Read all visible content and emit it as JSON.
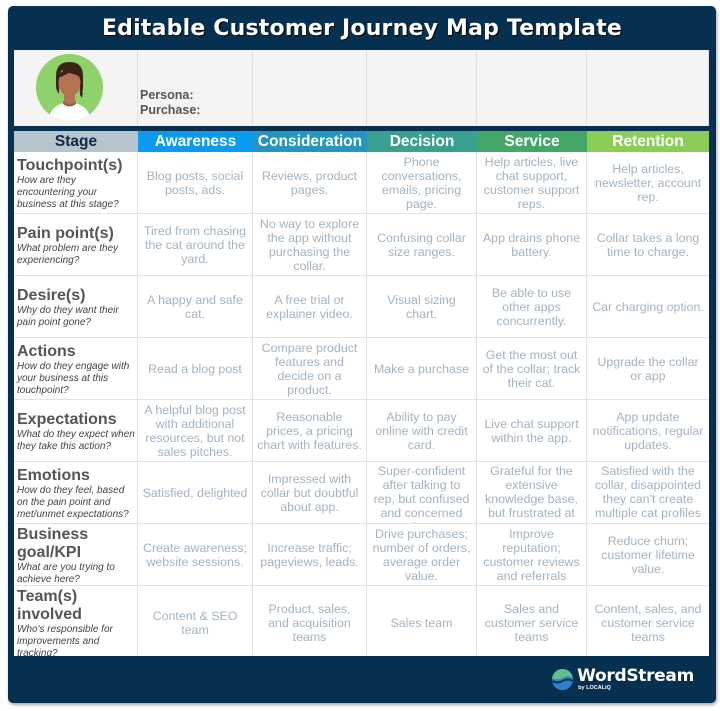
{
  "title": "Editable Customer Journey Map Template",
  "persona": {
    "persona_label": "Persona:",
    "purchase_label": "Purchase:"
  },
  "header": {
    "stage": {
      "label": "Stage",
      "color": "#b7c4cc"
    },
    "stages": [
      {
        "label": "Awareness",
        "color": "#0a9bef"
      },
      {
        "label": "Consideration",
        "color": "#2496c1"
      },
      {
        "label": "Decision",
        "color": "#3aa090"
      },
      {
        "label": "Service",
        "color": "#44a667"
      },
      {
        "label": "Retention",
        "color": "#8ccd58"
      }
    ]
  },
  "rows": [
    {
      "title": "Touchpoint(s)",
      "subtitle": "How are they encountering your business at this stage?",
      "cells": [
        "Blog posts, social posts, ads.",
        "Reviews, product pages.",
        "Phone conversations, emails, pricing page.",
        "Help articles, live chat support, customer support reps.",
        "Help articles, newsletter, account rep."
      ]
    },
    {
      "title": "Pain point(s)",
      "subtitle": "What problem are they experiencing?",
      "cells": [
        "Tired from chasing the cat around the yard.",
        "No way to explore the app without purchasing the collar.",
        "Confusing collar size ranges.",
        "App drains phone battery.",
        "Collar takes a long time to charge."
      ]
    },
    {
      "title": "Desire(s)",
      "subtitle": "Why do they want their pain point gone?",
      "cells": [
        "A happy and safe cat.",
        "A free trial or explainer video.",
        "Visual sizing chart.",
        "Be able to use other apps concurrently.",
        "Car charging option."
      ]
    },
    {
      "title": "Actions",
      "subtitle": "How do they engage with your business at this touchpoint?",
      "cells": [
        "Read a blog post",
        "Compare product features and decide on a product.",
        "Make a purchase",
        "Get the most out of the collar; track their cat.",
        "Upgrade the collar or app"
      ]
    },
    {
      "title": "Expectations",
      "subtitle": "What do they expect when they take this action?",
      "cells": [
        "A helpful blog post with additional resources, but not sales pitches.",
        "Reasonable prices, a pricing chart with features.",
        "Ability to pay online with credit card.",
        "Live chat support within the app.",
        "App update notifications, regular updates."
      ]
    },
    {
      "title": "Emotions",
      "subtitle": "How do they feel, based on the pain point and met/unmet expectations?",
      "cells": [
        "Satisfied, delighted",
        "Impressed with collar but doubtful about app.",
        "Super-confident after talking to rep, but confused and concerned about",
        "Grateful for the extensive knowledge base, but frustrated at not",
        "Satisfied with the collar,  disappointed they can't create multiple cat profiles"
      ]
    },
    {
      "title": "Business goal/KPI",
      "subtitle": "What are you trying to achieve here?",
      "cells": [
        "Create awareness; website sessions.",
        "Increase traffic; pageviews, leads.",
        "Drive purchases; number of orders, average order value.",
        "Improve reputation; customer reviews and referrals",
        "Reduce churn; customer lifetime value."
      ]
    },
    {
      "title": "Team(s) involved",
      "subtitle": "Who's responsible for improvements and tracking?",
      "cells": [
        "Content & SEO team",
        "Product, sales, and acquisition teams",
        "Sales team",
        "Sales and customer service teams",
        "Content, sales, and customer service teams"
      ]
    }
  ],
  "footer": {
    "brand": "WordStream",
    "by": "by LOCALiQ"
  },
  "colors": {
    "frame": "#06304f",
    "cell_text": "#a3b3c1",
    "avatar_bg": "#8fd16a"
  }
}
